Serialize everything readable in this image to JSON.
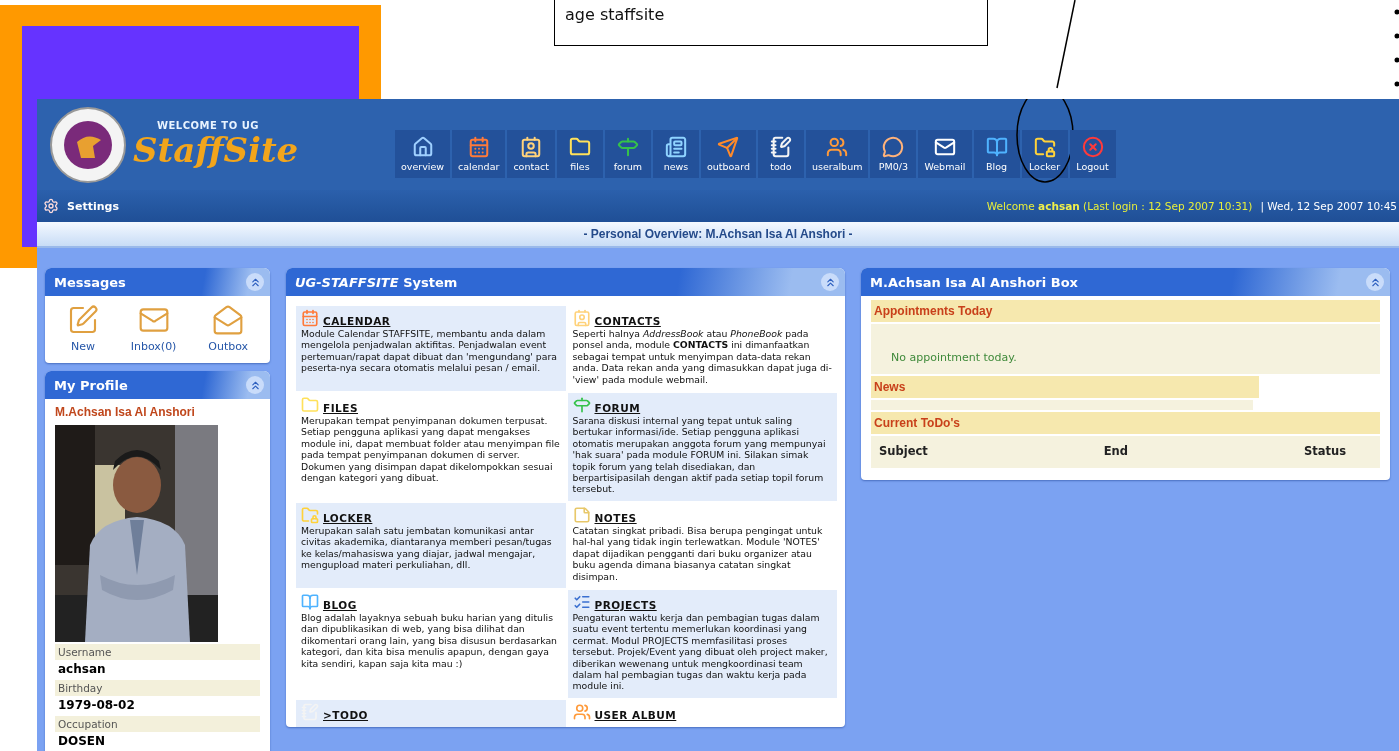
{
  "slide": {
    "callout_text": "age staffsite"
  },
  "header": {
    "tagline": "WELCOME TO UG",
    "logo_text": "StaffSite"
  },
  "toolbar": [
    {
      "label": "overview",
      "kind": "home",
      "circled": false
    },
    {
      "label": "calendar",
      "kind": "calendar",
      "circled": false
    },
    {
      "label": "contact",
      "kind": "contact",
      "circled": false
    },
    {
      "label": "files",
      "kind": "folder",
      "circled": false
    },
    {
      "label": "forum",
      "kind": "forum",
      "circled": false
    },
    {
      "label": "news",
      "kind": "news",
      "circled": false
    },
    {
      "label": "outboard",
      "kind": "outboard",
      "circled": false
    },
    {
      "label": "todo",
      "kind": "todo",
      "circled": false
    },
    {
      "label": "useralbum",
      "kind": "users",
      "circled": false
    },
    {
      "label": "PM0/3",
      "kind": "pm",
      "circled": false
    },
    {
      "label": "Webmail",
      "kind": "mail",
      "circled": false
    },
    {
      "label": "Blog",
      "kind": "book",
      "circled": false
    },
    {
      "label": "Locker",
      "kind": "locker",
      "circled": true
    },
    {
      "label": "Logout",
      "kind": "logout",
      "circled": false
    }
  ],
  "settings_bar": {
    "label": "Settings",
    "welcome": "Welcome **achsan** (Last login : 12 Sep 2007 10:31)",
    "date": "| Wed, 12 Sep 2007 10:45"
  },
  "overview_title": "- Personal Overview: M.Achsan Isa Al Anshori -",
  "messages": {
    "title": "Messages",
    "items": [
      {
        "label": "New",
        "kind": "new"
      },
      {
        "label": "Inbox(0)",
        "kind": "inbox"
      },
      {
        "label": "Outbox",
        "kind": "outbox"
      }
    ]
  },
  "profile": {
    "title": "My Profile",
    "name": "M.Achsan Isa Al Anshori",
    "fields": [
      {
        "label": "Username",
        "value": "achsan"
      },
      {
        "label": "Birthday",
        "value": "1979-08-02"
      },
      {
        "label": "Occupation",
        "value": "DOSEN"
      }
    ]
  },
  "system": {
    "title": "*UG-STAFFSITE* System",
    "modules": [
      {
        "kind": "calendar",
        "title": "CALENDAR",
        "text": "Module Calendar STAFFSITE, membantu anda dalam mengelola penjadwalan aktifitas. Penjadwalan event pertemuan/rapat dapat dibuat dan 'mengundang' para peserta-nya secara otomatis melalui pesan / email."
      },
      {
        "kind": "contact",
        "title": "CONTACTS",
        "text": "Seperti halnya *AddressBook* atau *PhoneBook* pada ponsel anda, module **CONTACTS** ini dimanfaatkan sebagai tempat untuk menyimpan data-data rekan anda. Data rekan anda yang dimasukkan dapat juga di-'view' pada module webmail."
      },
      {
        "kind": "folder",
        "title": "FILES",
        "text": "Merupakan tempat penyimpanan dokumen terpusat. Setiap pengguna aplikasi yang dapat mengakses module ini, dapat membuat folder atau menyimpan file pada tempat penyimpanan dokumen di server. Dokumen yang disimpan dapat dikelompokkan sesuai dengan kategori yang dibuat."
      },
      {
        "kind": "forum",
        "title": "FORUM",
        "text": "Sarana diskusi internal yang tepat untuk saling bertukar informasi/ide. Setiap pengguna aplikasi otomatis merupakan anggota forum yang mempunyai 'hak suara' pada module FORUM ini. Silakan simak topik forum yang telah disediakan, dan berpartisipasilah dengan aktif pada setiap topil forum tersebut."
      },
      {
        "kind": "locker",
        "title": "LOCKER",
        "text": "Merupakan salah satu jembatan komunikasi antar civitas akademika, diantaranya memberi pesan/tugas ke kelas/mahasiswa yang diajar, jadwal mengajar, mengupload materi perkuliahan, dll."
      },
      {
        "kind": "notes",
        "title": "NOTES",
        "text": "Catatan singkat pribadi. Bisa berupa pengingat untuk hal-hal yang tidak ingin terlewatkan. Module 'NOTES' dapat dijadikan pengganti dari buku organizer atau buku agenda dimana biasanya catatan singkat disimpan."
      },
      {
        "kind": "book",
        "title": "BLOG",
        "text": "Blog adalah layaknya sebuah buku harian yang ditulis dan dipublikasikan di web, yang bisa dilihat dan dikomentari orang lain, yang bisa disusun berdasarkan kategori, dan kita bisa menulis apapun, dengan gaya kita sendiri, kapan saja kita mau :)"
      },
      {
        "kind": "projects",
        "title": "PROJECTS",
        "text": "Pengaturan waktu kerja dan pembagian tugas dalam suatu event tertentu memerlukan koordinasi yang cermat. Modul PROJECTS memfasilitasi proses tersebut. Projek/Event yang dibuat oleh project maker, diberikan wewenang untuk mengkoordinasi team dalam hal pembagian tugas dan waktu kerja pada module ini."
      },
      {
        "kind": "todo",
        "title": ">TODO"
      },
      {
        "kind": "users",
        "title": "USER ALBUM"
      }
    ]
  },
  "box": {
    "title": "M.Achsan Isa Al Anshori Box",
    "appointments": {
      "title": "Appointments Today",
      "message": "No appointment today."
    },
    "news": {
      "title": "News"
    },
    "todos": {
      "title": "Current ToDo's",
      "columns": [
        "Subject",
        "End",
        "Status"
      ]
    }
  }
}
